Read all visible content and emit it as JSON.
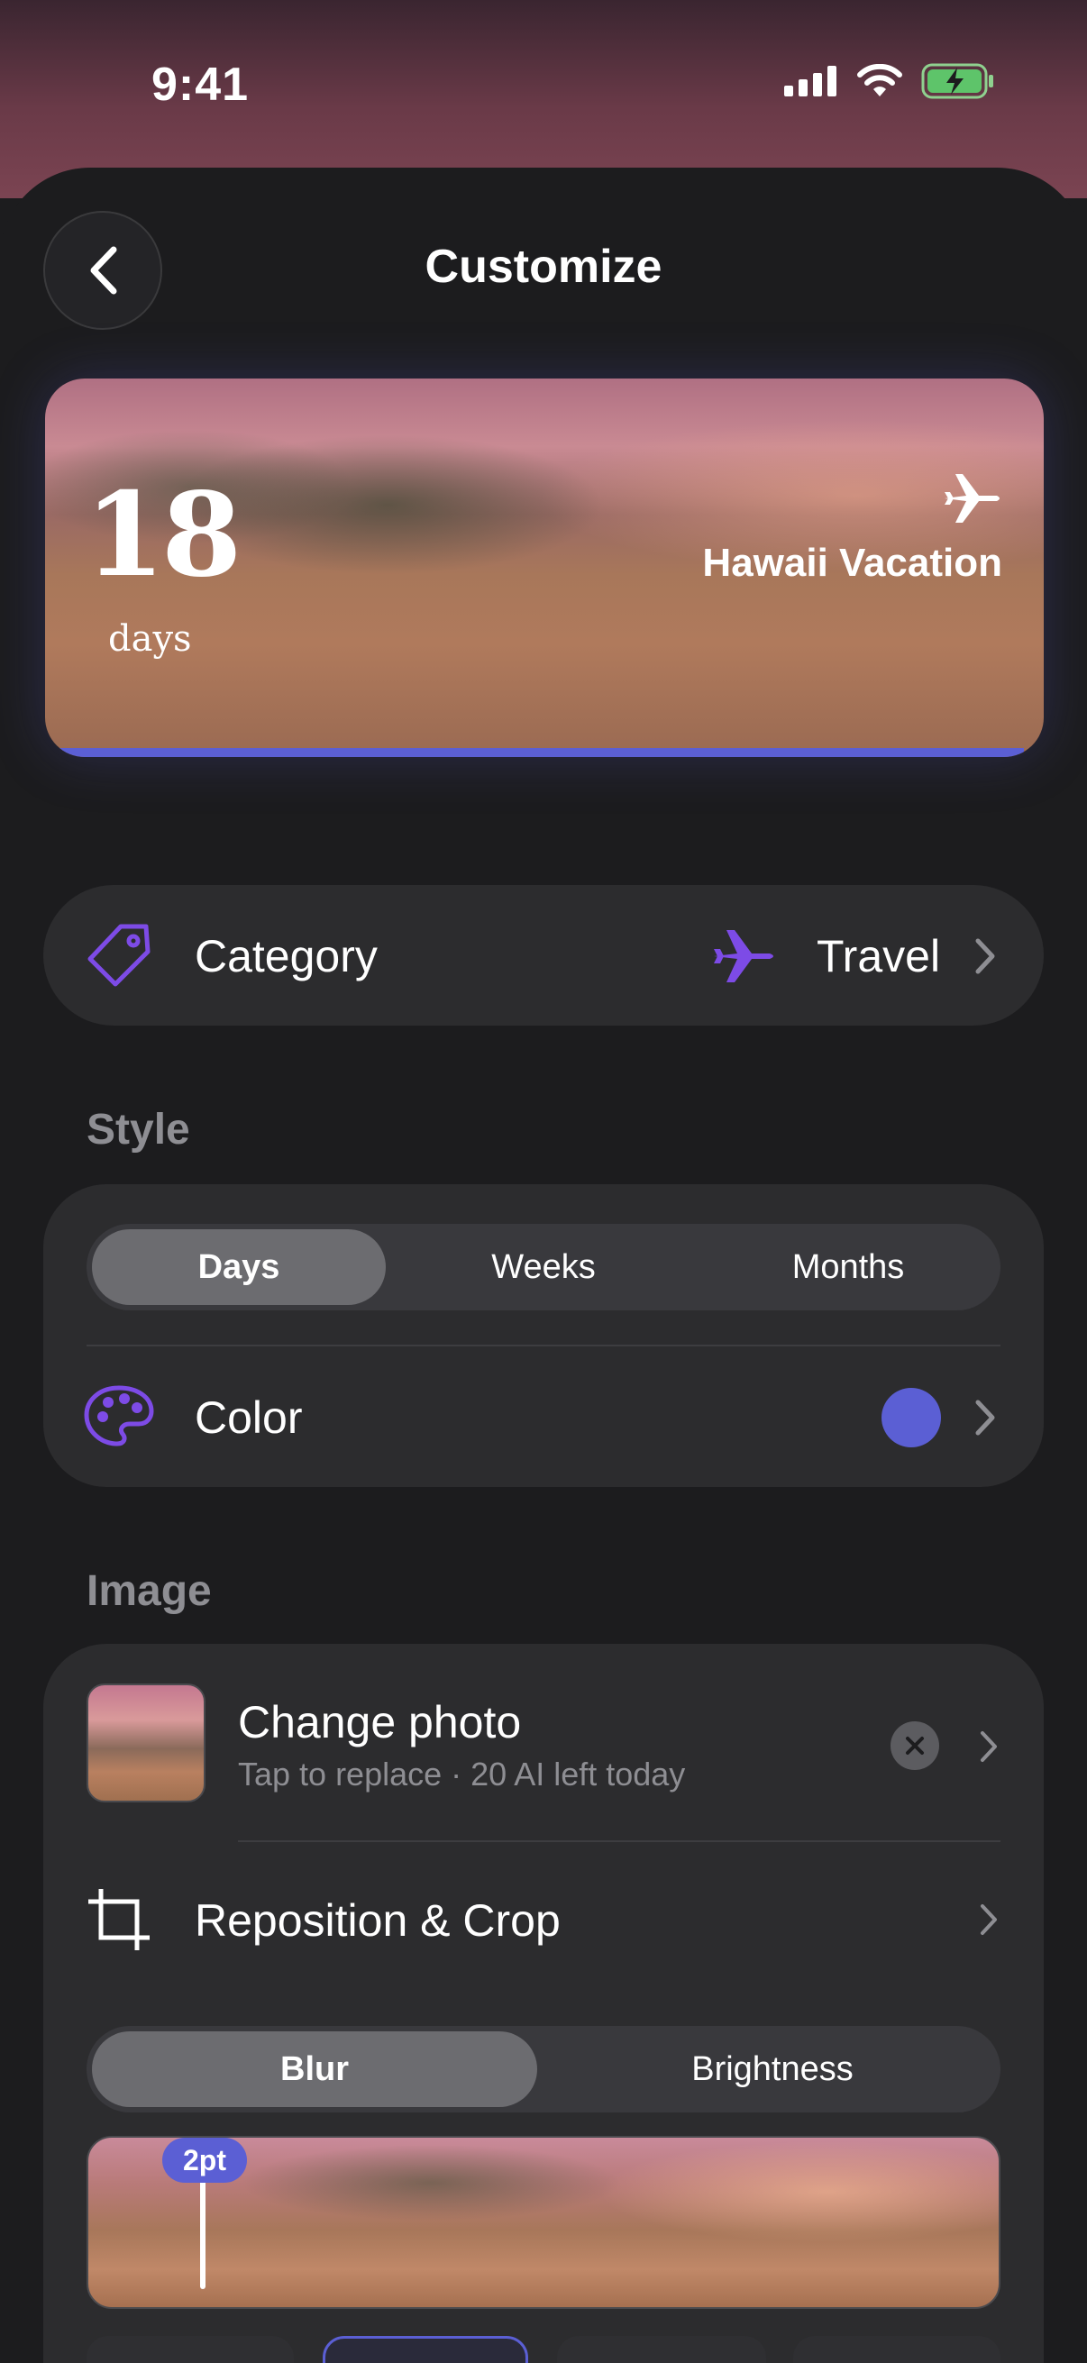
{
  "status_bar": {
    "time": "9:41"
  },
  "header": {
    "title": "Customize"
  },
  "preview": {
    "count": "18",
    "unit": "days",
    "event_name": "Hawaii Vacation",
    "icon": "airplane-icon",
    "progress_fraction": 0.98
  },
  "category": {
    "label": "Category",
    "value": "Travel",
    "icon": "tag-icon",
    "value_icon": "airplane-icon"
  },
  "style": {
    "section_label": "Style",
    "segments": [
      "Days",
      "Weeks",
      "Months"
    ],
    "selected_segment": "Days",
    "color_label": "Color",
    "color_icon": "palette-icon",
    "selected_color": "#5b5fd4"
  },
  "image": {
    "section_label": "Image",
    "change_photo_title": "Change photo",
    "change_photo_subtitle": "Tap to replace · 20 AI left today",
    "reposition_label": "Reposition & Crop",
    "adjust_segments": [
      "Blur",
      "Brightness"
    ],
    "selected_adjust": "Blur",
    "blur_value": "2pt"
  },
  "colors": {
    "accent": "#5b5fd4",
    "purple_icon": "#7d4be6",
    "background": "#1c1c1e",
    "card": "#2c2c2e"
  }
}
